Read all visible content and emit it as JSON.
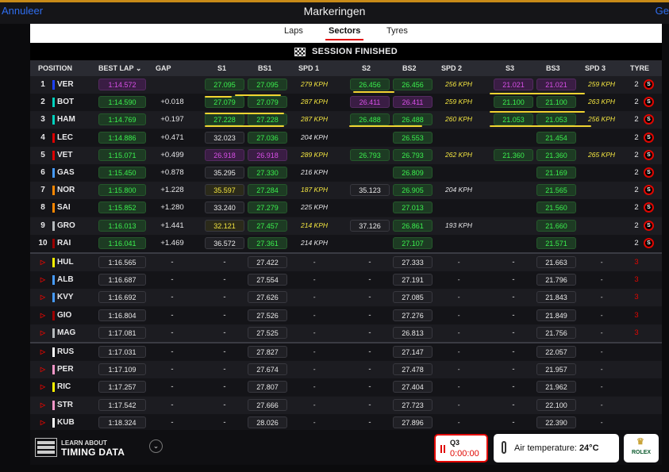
{
  "topbar": {
    "left": "Annuleer",
    "title": "Markeringen",
    "right": "Ge"
  },
  "tabs": [
    {
      "label": "Laps"
    },
    {
      "label": "Sectors"
    },
    {
      "label": "Tyres"
    }
  ],
  "active_tab": "Sectors",
  "status": "SESSION FINISHED",
  "columns": {
    "position": "POSITION",
    "best_lap": "BEST LAP",
    "gap": "GAP",
    "s1": "S1",
    "bs1": "BS1",
    "spd1": "SPD 1",
    "s2": "S2",
    "bs2": "BS2",
    "spd2": "SPD 2",
    "s3": "S3",
    "bs3": "BS3",
    "spd3": "SPD 3",
    "tyre": "TYRE"
  },
  "rows": [
    {
      "pos": "1",
      "drv": "VER",
      "team": "#1e41ff",
      "best": "1:14.572",
      "gap": "",
      "s1": "27.095",
      "s1c": "green",
      "bs1": "27.095",
      "bs1c": "green",
      "spd1": "279 KPH",
      "spd1c": "#f4e640",
      "s2": "26.456",
      "s2c": "green",
      "bs2": "26.456",
      "bs2c": "green",
      "spd2": "256 KPH",
      "spd2c": "#f4e640",
      "s3": "21.021",
      "s3c": "purple",
      "bs3": "21.021",
      "bs3c": "purple",
      "spd3": "259 KPH",
      "spd3c": "#f4e640",
      "tyre": "2",
      "bestc": "purple",
      "tyrec": "red"
    },
    {
      "pos": "2",
      "drv": "BOT",
      "team": "#00d2be",
      "best": "1:14.590",
      "gap": "+0.018",
      "s1": "27.079",
      "s1c": "green",
      "bs1": "27.079",
      "bs1c": "green",
      "spd1": "287 KPH",
      "spd1c": "#f4e640",
      "s2": "26.411",
      "s2c": "purple",
      "bs2": "26.411",
      "bs2c": "purple",
      "spd2": "259 KPH",
      "spd2c": "#f4e640",
      "s3": "21.100",
      "s3c": "green",
      "bs3": "21.100",
      "bs3c": "green",
      "spd3": "263 KPH",
      "spd3c": "#f4e640",
      "tyre": "2",
      "bestc": "green",
      "tyrec": "red"
    },
    {
      "pos": "3",
      "drv": "HAM",
      "team": "#00d2be",
      "best": "1:14.769",
      "gap": "+0.197",
      "s1": "27.228",
      "s1c": "green",
      "bs1": "27.228",
      "bs1c": "green",
      "spd1": "287 KPH",
      "spd1c": "#f4e640",
      "s2": "26.488",
      "s2c": "green",
      "bs2": "26.488",
      "bs2c": "green",
      "spd2": "260 KPH",
      "spd2c": "#f4e640",
      "s3": "21.053",
      "s3c": "green",
      "bs3": "21.053",
      "bs3c": "green",
      "spd3": "256 KPH",
      "spd3c": "#f4e640",
      "tyre": "2",
      "bestc": "green",
      "tyrec": "red"
    },
    {
      "pos": "4",
      "drv": "LEC",
      "team": "#dc0000",
      "best": "1:14.886",
      "gap": "+0.471",
      "s1": "32.023",
      "s1c": "white",
      "bs1": "27.036",
      "bs1c": "green",
      "spd1": "204 KPH",
      "spd1c": "#e8e8ea",
      "s2": "",
      "s2c": "",
      "bs2": "26.553",
      "bs2c": "green",
      "spd2": "",
      "spd2c": "",
      "s3": "",
      "s3c": "",
      "bs3": "21.454",
      "bs3c": "green",
      "spd3": "",
      "spd3c": "",
      "tyre": "2",
      "bestc": "green",
      "tyrec": "red"
    },
    {
      "pos": "5",
      "drv": "VET",
      "team": "#dc0000",
      "best": "1:15.071",
      "gap": "+0.499",
      "s1": "26.918",
      "s1c": "purple",
      "bs1": "26.918",
      "bs1c": "purple",
      "spd1": "289 KPH",
      "spd1c": "#f4e640",
      "s2": "26.793",
      "s2c": "green",
      "bs2": "26.793",
      "bs2c": "green",
      "spd2": "262 KPH",
      "spd2c": "#f4e640",
      "s3": "21.360",
      "s3c": "green",
      "bs3": "21.360",
      "bs3c": "green",
      "spd3": "265 KPH",
      "spd3c": "#f4e640",
      "tyre": "2",
      "bestc": "green",
      "tyrec": "red"
    },
    {
      "pos": "6",
      "drv": "GAS",
      "team": "#469bff",
      "best": "1:15.450",
      "gap": "+0.878",
      "s1": "35.295",
      "s1c": "white",
      "bs1": "27.330",
      "bs1c": "green",
      "spd1": "216 KPH",
      "spd1c": "#e8e8ea",
      "s2": "",
      "s2c": "",
      "bs2": "26.809",
      "bs2c": "green",
      "spd2": "",
      "spd2c": "",
      "s3": "",
      "s3c": "",
      "bs3": "21.169",
      "bs3c": "green",
      "spd3": "",
      "spd3c": "",
      "tyre": "2",
      "bestc": "green",
      "tyrec": "red"
    },
    {
      "pos": "7",
      "drv": "NOR",
      "team": "#ff8700",
      "best": "1:15.800",
      "gap": "+1.228",
      "s1": "35.597",
      "s1c": "yellow",
      "bs1": "27.284",
      "bs1c": "green",
      "spd1": "187 KPH",
      "spd1c": "#f4e640",
      "s2": "35.123",
      "s2c": "white",
      "bs2": "26.905",
      "bs2c": "green",
      "spd2": "204 KPH",
      "spd2c": "#e8e8ea",
      "s3": "",
      "s3c": "",
      "bs3": "21.565",
      "bs3c": "green",
      "spd3": "",
      "spd3c": "",
      "tyre": "2",
      "bestc": "green",
      "tyrec": "red"
    },
    {
      "pos": "8",
      "drv": "SAI",
      "team": "#ff8700",
      "best": "1:15.852",
      "gap": "+1.280",
      "s1": "33.240",
      "s1c": "white",
      "bs1": "27.279",
      "bs1c": "green",
      "spd1": "225 KPH",
      "spd1c": "#e8e8ea",
      "s2": "",
      "s2c": "",
      "bs2": "27.013",
      "bs2c": "green",
      "spd2": "",
      "spd2c": "",
      "s3": "",
      "s3c": "",
      "bs3": "21.560",
      "bs3c": "green",
      "spd3": "",
      "spd3c": "",
      "tyre": "2",
      "bestc": "green",
      "tyrec": "red"
    },
    {
      "pos": "9",
      "drv": "GRO",
      "team": "#b6babd",
      "best": "1:16.013",
      "gap": "+1.441",
      "s1": "32.121",
      "s1c": "yellow",
      "bs1": "27.457",
      "bs1c": "green",
      "spd1": "214 KPH",
      "spd1c": "#f4e640",
      "s2": "37.126",
      "s2c": "white",
      "bs2": "26.861",
      "bs2c": "green",
      "spd2": "193 KPH",
      "spd2c": "#e8e8ea",
      "s3": "",
      "s3c": "",
      "bs3": "21.660",
      "bs3c": "green",
      "spd3": "",
      "spd3c": "",
      "tyre": "2",
      "bestc": "green",
      "tyrec": "red"
    },
    {
      "pos": "10",
      "drv": "RAI",
      "team": "#9b0000",
      "best": "1:16.041",
      "gap": "+1.469",
      "s1": "36.572",
      "s1c": "white",
      "bs1": "27.361",
      "bs1c": "green",
      "spd1": "214 KPH",
      "spd1c": "#e8e8ea",
      "s2": "",
      "s2c": "",
      "bs2": "27.107",
      "bs2c": "green",
      "spd2": "",
      "spd2c": "",
      "s3": "",
      "s3c": "",
      "bs3": "21.571",
      "bs3c": "green",
      "spd3": "",
      "spd3c": "",
      "tyre": "2",
      "bestc": "green",
      "tyrec": "red"
    },
    {
      "pos": "▷",
      "drv": "HUL",
      "team": "#fff500",
      "best": "1:16.565",
      "gap": "-",
      "s1": "-",
      "s1c": "",
      "bs1": "27.422",
      "bs1c": "white",
      "spd1": "-",
      "spd1c": "#e8e8ea",
      "s2": "-",
      "s2c": "",
      "bs2": "27.333",
      "bs2c": "white",
      "spd2": "-",
      "spd2c": "#e8e8ea",
      "s3": "-",
      "s3c": "",
      "bs3": "21.663",
      "bs3c": "white",
      "spd3": "-",
      "spd3c": "#e8e8ea",
      "tyre": "3",
      "bestc": "white",
      "tyrec": "none"
    },
    {
      "pos": "▷",
      "drv": "ALB",
      "team": "#469bff",
      "best": "1:16.687",
      "gap": "-",
      "s1": "-",
      "s1c": "",
      "bs1": "27.554",
      "bs1c": "white",
      "spd1": "-",
      "spd1c": "#e8e8ea",
      "s2": "-",
      "s2c": "",
      "bs2": "27.191",
      "bs2c": "white",
      "spd2": "-",
      "spd2c": "#e8e8ea",
      "s3": "-",
      "s3c": "",
      "bs3": "21.796",
      "bs3c": "white",
      "spd3": "-",
      "spd3c": "#e8e8ea",
      "tyre": "3",
      "bestc": "white",
      "tyrec": "none"
    },
    {
      "pos": "▷",
      "drv": "KVY",
      "team": "#469bff",
      "best": "1:16.692",
      "gap": "-",
      "s1": "-",
      "s1c": "",
      "bs1": "27.626",
      "bs1c": "white",
      "spd1": "-",
      "spd1c": "#e8e8ea",
      "s2": "-",
      "s2c": "",
      "bs2": "27.085",
      "bs2c": "white",
      "spd2": "-",
      "spd2c": "#e8e8ea",
      "s3": "-",
      "s3c": "",
      "bs3": "21.843",
      "bs3c": "white",
      "spd3": "-",
      "spd3c": "#e8e8ea",
      "tyre": "3",
      "bestc": "white",
      "tyrec": "none"
    },
    {
      "pos": "▷",
      "drv": "GIO",
      "team": "#9b0000",
      "best": "1:16.804",
      "gap": "-",
      "s1": "-",
      "s1c": "",
      "bs1": "27.526",
      "bs1c": "white",
      "spd1": "-",
      "spd1c": "#e8e8ea",
      "s2": "-",
      "s2c": "",
      "bs2": "27.276",
      "bs2c": "white",
      "spd2": "-",
      "spd2c": "#e8e8ea",
      "s3": "-",
      "s3c": "",
      "bs3": "21.849",
      "bs3c": "white",
      "spd3": "-",
      "spd3c": "#e8e8ea",
      "tyre": "3",
      "bestc": "white",
      "tyrec": "none"
    },
    {
      "pos": "▷",
      "drv": "MAG",
      "team": "#b6babd",
      "best": "1:17.081",
      "gap": "-",
      "s1": "-",
      "s1c": "",
      "bs1": "27.525",
      "bs1c": "white",
      "spd1": "-",
      "spd1c": "#e8e8ea",
      "s2": "-",
      "s2c": "",
      "bs2": "26.813",
      "bs2c": "white",
      "spd2": "-",
      "spd2c": "#e8e8ea",
      "s3": "-",
      "s3c": "",
      "bs3": "21.756",
      "bs3c": "white",
      "spd3": "-",
      "spd3c": "#e8e8ea",
      "tyre": "3",
      "bestc": "white",
      "tyrec": "none"
    },
    {
      "pos": "▷",
      "drv": "RUS",
      "team": "#ffffff",
      "best": "1:17.031",
      "gap": "-",
      "s1": "-",
      "s1c": "",
      "bs1": "27.827",
      "bs1c": "white",
      "spd1": "-",
      "spd1c": "#e8e8ea",
      "s2": "-",
      "s2c": "",
      "bs2": "27.147",
      "bs2c": "white",
      "spd2": "-",
      "spd2c": "#e8e8ea",
      "s3": "-",
      "s3c": "",
      "bs3": "22.057",
      "bs3c": "white",
      "spd3": "-",
      "spd3c": "#e8e8ea",
      "tyre": "",
      "bestc": "white",
      "tyrec": "none"
    },
    {
      "pos": "▷",
      "drv": "PER",
      "team": "#f596c8",
      "best": "1:17.109",
      "gap": "-",
      "s1": "-",
      "s1c": "",
      "bs1": "27.674",
      "bs1c": "white",
      "spd1": "-",
      "spd1c": "#e8e8ea",
      "s2": "-",
      "s2c": "",
      "bs2": "27.478",
      "bs2c": "white",
      "spd2": "-",
      "spd2c": "#e8e8ea",
      "s3": "-",
      "s3c": "",
      "bs3": "21.957",
      "bs3c": "white",
      "spd3": "-",
      "spd3c": "#e8e8ea",
      "tyre": "",
      "bestc": "white",
      "tyrec": "none"
    },
    {
      "pos": "▷",
      "drv": "RIC",
      "team": "#fff500",
      "best": "1:17.257",
      "gap": "-",
      "s1": "-",
      "s1c": "",
      "bs1": "27.807",
      "bs1c": "white",
      "spd1": "-",
      "spd1c": "#e8e8ea",
      "s2": "-",
      "s2c": "",
      "bs2": "27.404",
      "bs2c": "white",
      "spd2": "-",
      "spd2c": "#e8e8ea",
      "s3": "-",
      "s3c": "",
      "bs3": "21.962",
      "bs3c": "white",
      "spd3": "-",
      "spd3c": "#e8e8ea",
      "tyre": "",
      "bestc": "white",
      "tyrec": "none"
    },
    {
      "pos": "▷",
      "drv": "STR",
      "team": "#f596c8",
      "best": "1:17.542",
      "gap": "-",
      "s1": "-",
      "s1c": "",
      "bs1": "27.666",
      "bs1c": "white",
      "spd1": "-",
      "spd1c": "#e8e8ea",
      "s2": "-",
      "s2c": "",
      "bs2": "27.723",
      "bs2c": "white",
      "spd2": "-",
      "spd2c": "#e8e8ea",
      "s3": "-",
      "s3c": "",
      "bs3": "22.100",
      "bs3c": "white",
      "spd3": "-",
      "spd3c": "#e8e8ea",
      "tyre": "",
      "bestc": "white",
      "tyrec": "none"
    },
    {
      "pos": "▷",
      "drv": "KUB",
      "team": "#ffffff",
      "best": "1:18.324",
      "gap": "-",
      "s1": "-",
      "s1c": "",
      "bs1": "28.026",
      "bs1c": "white",
      "spd1": "-",
      "spd1c": "#e8e8ea",
      "s2": "-",
      "s2c": "",
      "bs2": "27.896",
      "bs2c": "white",
      "spd2": "-",
      "spd2c": "#e8e8ea",
      "s3": "-",
      "s3c": "",
      "bs3": "22.390",
      "bs3c": "white",
      "spd3": "-",
      "spd3c": "#e8e8ea",
      "tyre": "",
      "bestc": "white",
      "tyrec": "none"
    }
  ],
  "footer": {
    "learn_top": "LEARN ABOUT",
    "learn_bottom": "TIMING DATA",
    "q3_label": "Q3",
    "q3_time": "0:00:00",
    "air_label": "Air temperature:",
    "air_value": "24°C",
    "sponsor": "ROLEX"
  },
  "colors": {
    "accent": "#e10600",
    "green": "#3bf04e",
    "purple": "#d74fe6",
    "yellow": "#f4e640"
  }
}
